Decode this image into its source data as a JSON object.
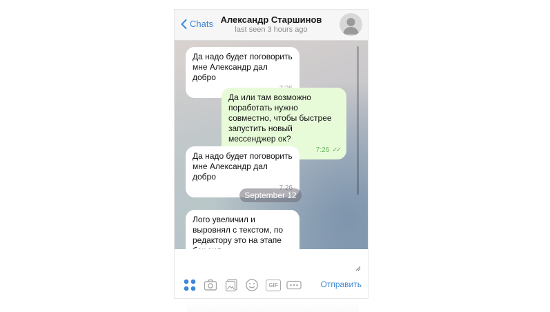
{
  "header": {
    "back_label": "Chats",
    "contact_name": "Александр Старшинов",
    "status": "last seen 3 hours ago"
  },
  "messages": [
    {
      "direction": "in",
      "text": "Да надо будет поговорить мне Александр дал добро",
      "time": "7:26"
    },
    {
      "direction": "out",
      "text": "Да или там возможно поработать нужно совместно, чтобы быстрее запустить новый мессенджер ок?",
      "time": "7:26"
    },
    {
      "direction": "in",
      "text": "Да надо будет поговорить мне Александр дал добро",
      "time": "7:26"
    },
    {
      "direction": "in",
      "text": "Лого увеличил и выровнял с текстом, по редактору это на этапе бек энд",
      "time": ""
    }
  ],
  "date_separator": "September 12",
  "composer": {
    "placeholder": "",
    "send_label": "Отправить",
    "gif_label": "GIF"
  },
  "colors": {
    "accent": "#3b87d6",
    "outgoing_bubble": "#e8fbd9",
    "incoming_bubble": "#ffffff",
    "read_ticks": "#66b75f"
  }
}
